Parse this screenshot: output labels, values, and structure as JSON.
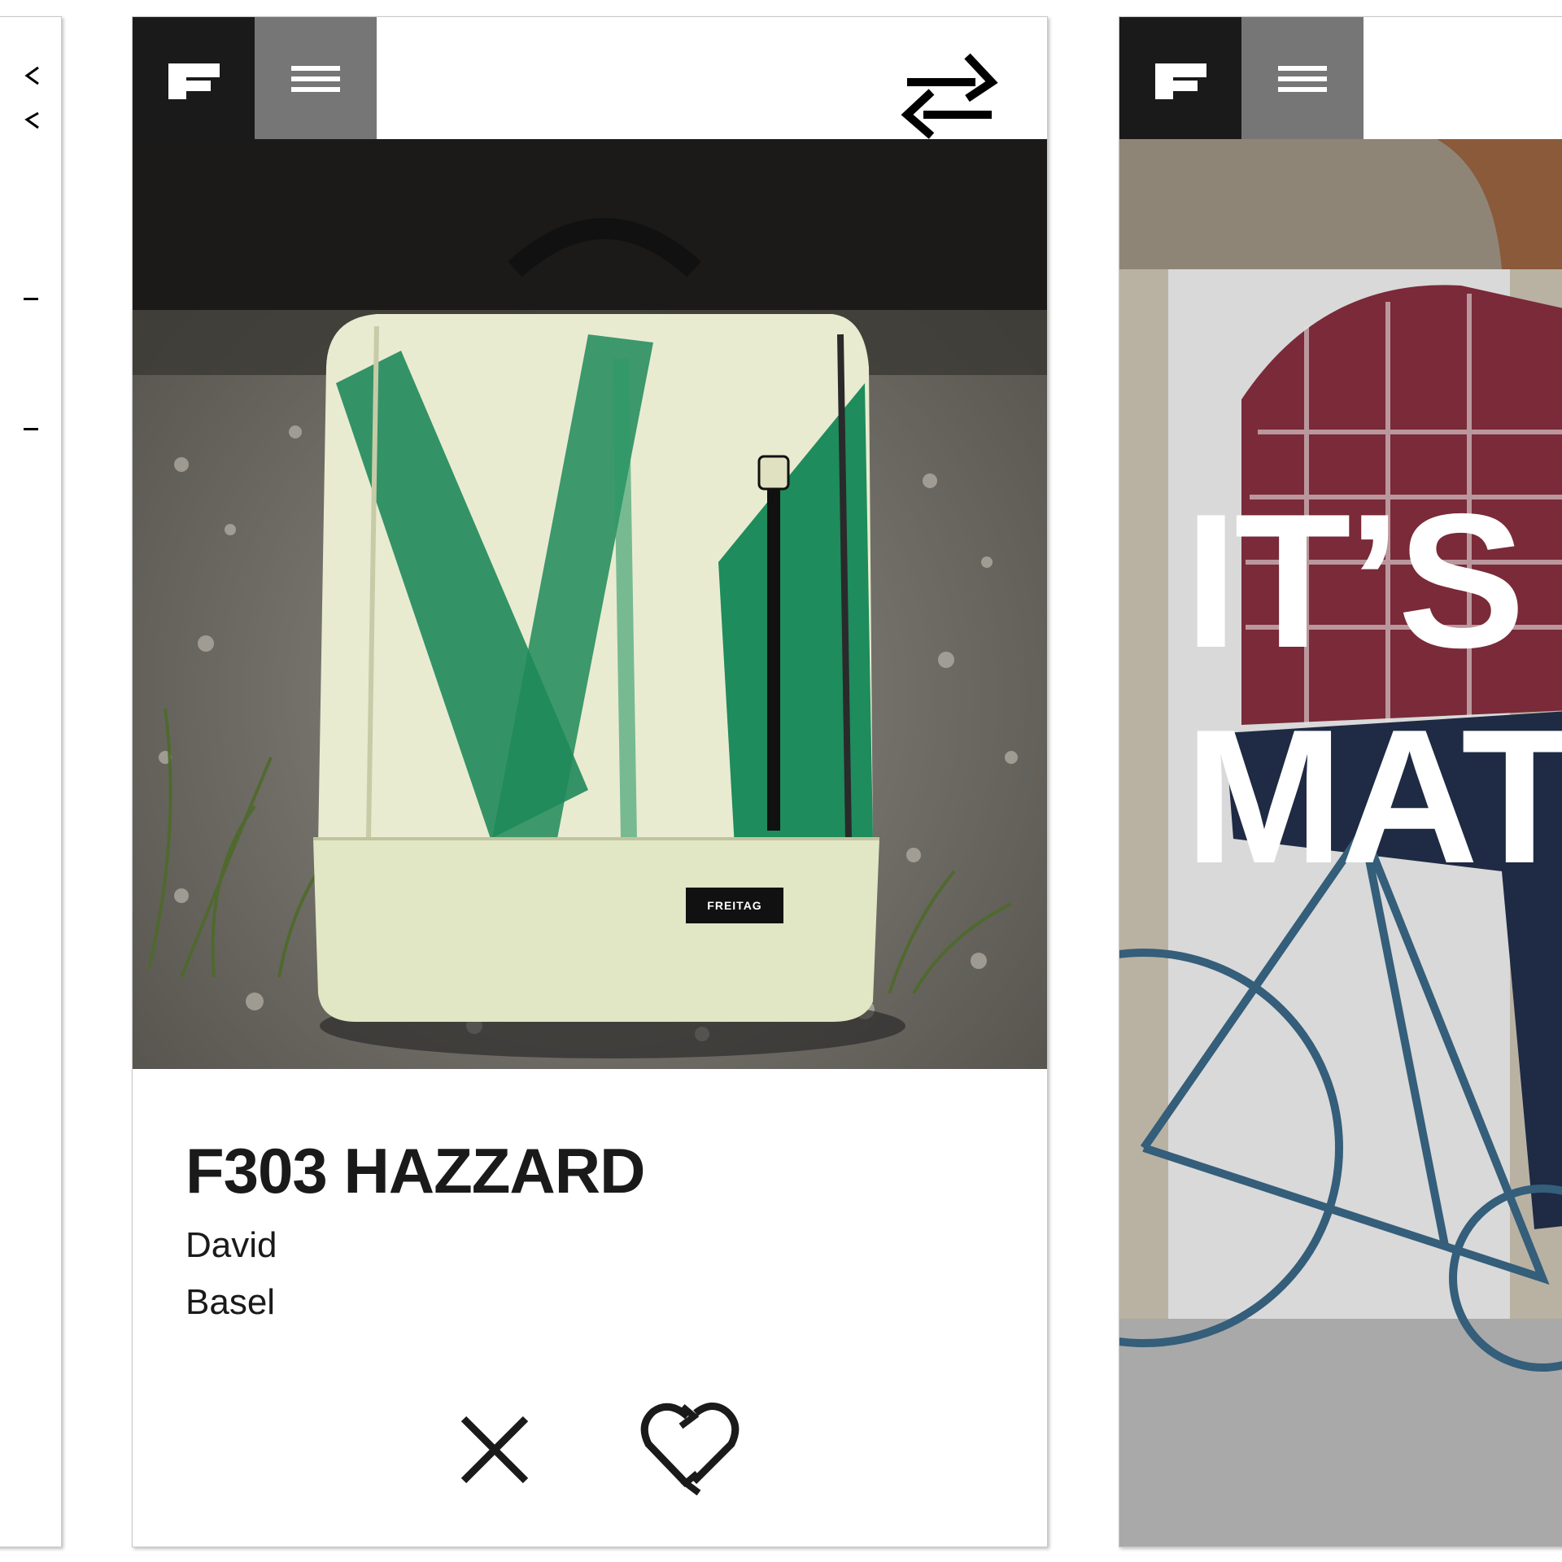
{
  "center_screen": {
    "header": {
      "logo_icon": "freitag-f-logo-icon",
      "menu_icon": "hamburger-menu-icon",
      "swap_icon": "swap-arrows-icon"
    },
    "product": {
      "name": "F303 HAZZARD",
      "owner": "David",
      "city": "Basel",
      "bag_label": "FREITAG"
    },
    "actions": {
      "dismiss_icon": "close-x-icon",
      "like_icon": "recycle-heart-icon"
    }
  },
  "right_screen": {
    "headline_line1": "IT’S",
    "headline_line2": "MAT"
  },
  "colors": {
    "logo_bg": "#1a1a1a",
    "menu_bg": "#767676",
    "bag_green": "#1f8a5a",
    "bag_cream": "#e9ebd0"
  }
}
